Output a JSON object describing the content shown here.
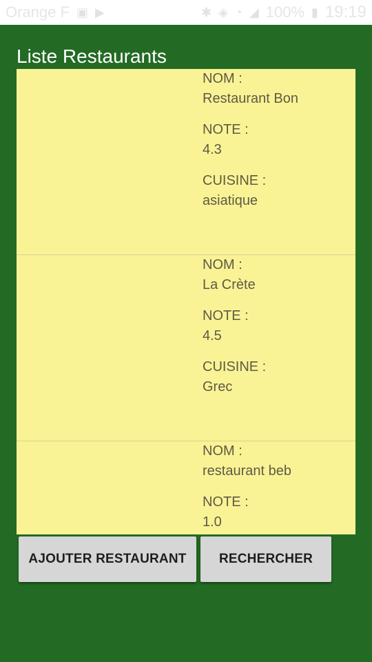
{
  "status_bar": {
    "carrier": "Orange F",
    "battery": "100%",
    "time": "19:19"
  },
  "app": {
    "title": "Liste Restaurants"
  },
  "labels": {
    "nom": "NOM :",
    "note": "NOTE :",
    "cuisine": "CUISINE :"
  },
  "restaurants": [
    {
      "nom": "Restaurant Bon",
      "note": "4.3",
      "cuisine": "asiatique"
    },
    {
      "nom": "La Crète",
      "note": "4.5",
      "cuisine": "Grec"
    },
    {
      "nom": "restaurant beb",
      "note": "1.0",
      "cuisine": ""
    }
  ],
  "buttons": {
    "add": "AJOUTER RESTAURANT",
    "search": "RECHERCHER"
  }
}
